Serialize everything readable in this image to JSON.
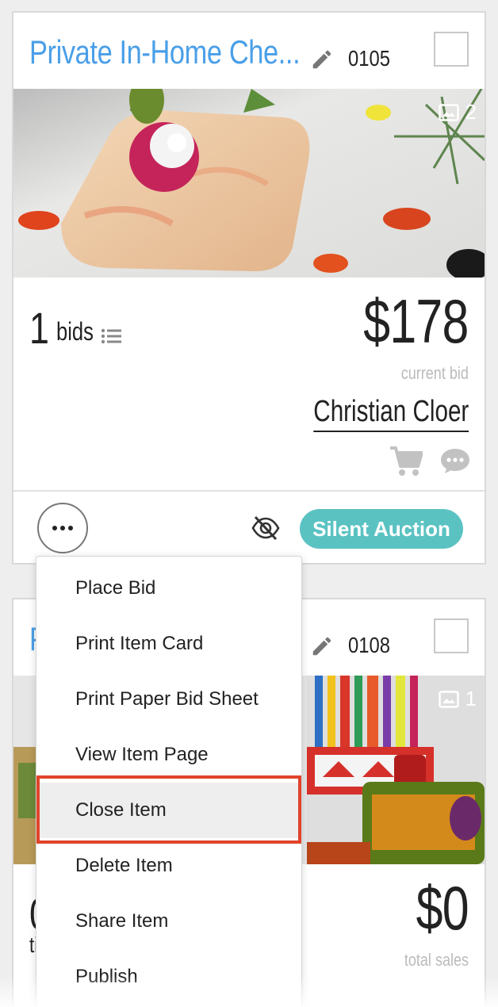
{
  "colors": {
    "title_blue": "#4a9fe8",
    "badge_teal": "#5bc2c2",
    "highlight_red": "#e0442b",
    "muted_gray": "#bbbbbb"
  },
  "card1": {
    "title": "Private In-Home Che...",
    "item_number": "0105",
    "photo_count": "2",
    "bids_count": "1",
    "bids_label": "bids",
    "price": "$178",
    "price_caption": "current bid",
    "bidder": "Christian Cloer",
    "badge": "Silent Auction",
    "icons": [
      "pencil-icon",
      "image-icon",
      "list-icon",
      "cart-icon",
      "chat-icon",
      "more-icon",
      "eye-off-icon"
    ]
  },
  "card2": {
    "title_fragment": "P",
    "item_number": "0108",
    "photo_count": "1",
    "left_number_fragment": "0",
    "left_label_fragment": "ti",
    "price": "$0",
    "price_caption": "total sales"
  },
  "menu": {
    "items": [
      "Place Bid",
      "Print Item Card",
      "Print Paper Bid Sheet",
      "View Item Page",
      "Close Item",
      "Delete Item",
      "Share Item",
      "Publish"
    ],
    "highlighted_item": "Close Item"
  }
}
